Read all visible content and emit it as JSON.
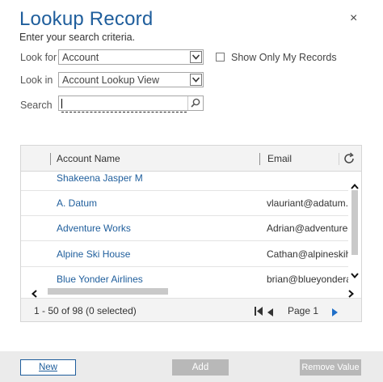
{
  "dialog": {
    "title": "Lookup Record",
    "subtitle": "Enter your search criteria.",
    "close_icon": "×"
  },
  "form": {
    "look_for_label": "Look for",
    "look_for_value": "Account",
    "look_in_label": "Look in",
    "look_in_value": "Account Lookup View",
    "search_label": "Search",
    "search_value": "",
    "show_only_mine_label": "Show Only My Records",
    "show_only_mine_checked": false
  },
  "grid": {
    "columns": [
      "Account Name",
      "Email"
    ],
    "rows": [
      {
        "name": "Shakeena Jasper M",
        "email": ""
      },
      {
        "name": "A. Datum",
        "email": "vlauriant@adatum.cc"
      },
      {
        "name": "Adventure Works",
        "email": "Adrian@adventure-w"
      },
      {
        "name": "Alpine Ski House",
        "email": "Cathan@alpineskiho"
      },
      {
        "name": "Blue Yonder Airlines",
        "email": "brian@blueyonderai"
      }
    ],
    "record_count_text": "1 - 50 of 98 (0 selected)",
    "page_label": "Page 1"
  },
  "buttons": {
    "new": "New",
    "add": "Add",
    "remove_value": "Remove Value"
  },
  "colors": {
    "accent": "#1f5e9c",
    "disabled_button": "#b8b8b8",
    "footer_bg": "#ebebeb"
  }
}
